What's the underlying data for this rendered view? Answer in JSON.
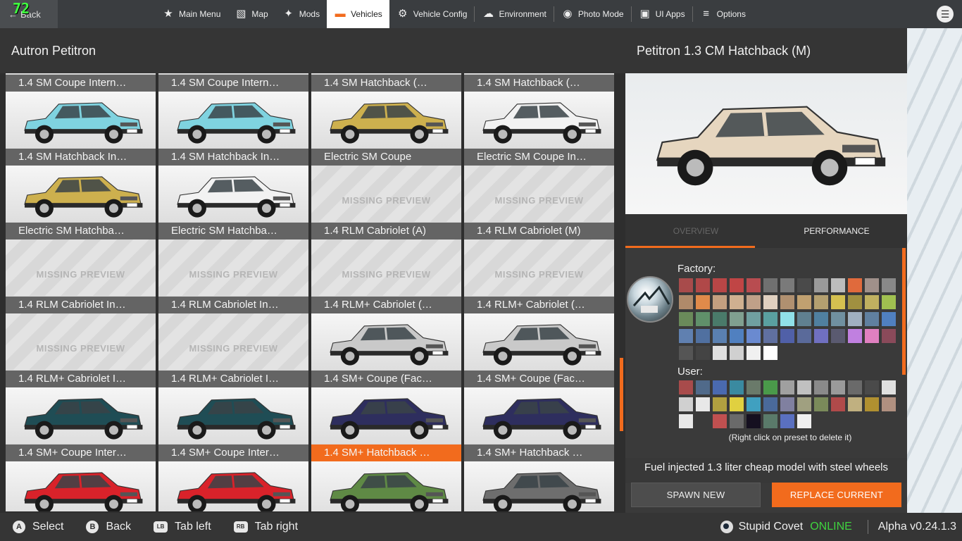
{
  "overlay": {
    "fps": "72"
  },
  "topbar": {
    "back_label": "Back",
    "nav": [
      {
        "label": "Main Menu",
        "icon": "star-square-icon"
      },
      {
        "label": "Map",
        "icon": "map-icon"
      },
      {
        "label": "Mods",
        "icon": "puzzle-icon"
      },
      {
        "label": "Vehicles",
        "icon": "car-icon",
        "active": true
      },
      {
        "label": "Vehicle Config",
        "icon": "engine-icon"
      },
      {
        "label": "Environment",
        "icon": "weather-icon"
      },
      {
        "label": "Photo Mode",
        "icon": "camera-icon"
      },
      {
        "label": "UI Apps",
        "icon": "apps-icon"
      },
      {
        "label": "Options",
        "icon": "sliders-icon"
      }
    ]
  },
  "list": {
    "title": "Autron Petitron",
    "missing_preview": "MISSING PREVIEW",
    "top_row": [
      "1.4 SM Coupe Intern…",
      "1.4 SM Coupe Intern…",
      "1.4 SM Hatchback (…",
      "1.4 SM Hatchback (…"
    ],
    "tiles": [
      {
        "label": "1.4 SM Hatchback In…",
        "color": "#7fd3e0"
      },
      {
        "label": "1.4 SM Hatchback In…",
        "color": "#7fd3e0"
      },
      {
        "label": "Electric SM Coupe",
        "color": "#cdb04e"
      },
      {
        "label": "Electric SM Coupe In…",
        "color": "#f2f2f2"
      },
      {
        "label": "Electric SM Hatchba…",
        "color": "#cdb04e"
      },
      {
        "label": "Electric SM Hatchba…",
        "color": "#f2f2f2"
      },
      {
        "label": "1.4 RLM Cabriolet (A)",
        "missing": true
      },
      {
        "label": "1.4 RLM Cabriolet (M)",
        "missing": true
      },
      {
        "label": "1.4 RLM Cabriolet In…",
        "missing": true
      },
      {
        "label": "1.4 RLM Cabriolet In…",
        "missing": true
      },
      {
        "label": "1.4 RLM+ Cabriolet (…",
        "missing": true
      },
      {
        "label": "1.4 RLM+ Cabriolet (…",
        "missing": true
      },
      {
        "label": "1.4 RLM+ Cabriolet I…",
        "missing": true
      },
      {
        "label": "1.4 RLM+ Cabriolet I…",
        "missing": true
      },
      {
        "label": "1.4 SM+ Coupe (Fac…",
        "color": "#c9c9c9"
      },
      {
        "label": "1.4 SM+ Coupe (Fac…",
        "color": "#c9c9c9"
      },
      {
        "label": "1.4 SM+ Coupe Inter…",
        "color": "#1f4d55"
      },
      {
        "label": "1.4 SM+ Coupe Inter…",
        "color": "#1f4d55"
      },
      {
        "label": "1.4 SM+ Hatchback …",
        "color": "#2e2e5e",
        "selected": true
      },
      {
        "label": "1.4 SM+ Hatchback …",
        "color": "#2e2e5e"
      },
      {
        "label": "",
        "color": "#d9222a"
      },
      {
        "label": "",
        "color": "#d9222a"
      },
      {
        "label": "",
        "color": "#5f8a45"
      },
      {
        "label": "",
        "color": "#6e6e6e"
      }
    ]
  },
  "detail": {
    "title": "Petitron 1.3 CM Hatchback (M)",
    "car_color": "#e6d6bf",
    "tabs": [
      "OVERVIEW",
      "PERFORMANCE"
    ],
    "factory_label": "Factory:",
    "user_label": "User:",
    "factory_colors": [
      "#a84b4b",
      "#b04848",
      "#b84646",
      "#c04545",
      "#b84c50",
      "#707070",
      "#7a7a7a",
      "#4a4a4a",
      "#9a9a9a",
      "#bcbcbc",
      "#e06a3c",
      "#a0908a",
      "#888888",
      "#b08a6a",
      "#e08a4a",
      "#c4a080",
      "#d0b090",
      "#c0a088",
      "#e0d0c0",
      "#b09070",
      "#c0a070",
      "#b4a070",
      "#d4c050",
      "#a09040",
      "#c0b060",
      "#a0c050",
      "#6a8a5a",
      "#60906a",
      "#4a7a6a",
      "#80a090",
      "#70a0a0",
      "#5aa0a0",
      "#90e0e8",
      "#608090",
      "#5080a0",
      "#7090a0",
      "#a0b0c0",
      "#6080a0",
      "#5080c0",
      "#6080b0",
      "#5070a0",
      "#5a80b0",
      "#5080c0",
      "#6a8ad0",
      "#6070a0",
      "#5060a8",
      "#5a6a9a",
      "#7070c0",
      "#5a5a70",
      "#c080e0",
      "#e080c0",
      "#8a4a5a",
      "#555555",
      "#444444",
      "#e0e0e0",
      "#d0d0d0",
      "#f0f0f0",
      "#ffffff"
    ],
    "user_colors": [
      "#a84b4b",
      "#506a8a",
      "#4a6ab0",
      "#3a8aa0",
      "#6a7a6a",
      "#4a9a4a",
      "#a0a0a0",
      "#c0c0c0",
      "#8a8a8a",
      "#9a9a9a",
      "#6a6a6a",
      "#4a4a4a",
      "#e0e0e0",
      "#d0d0d0",
      "#e8e8e8",
      "#b0a040",
      "#e0d040",
      "#40a0c0",
      "#4a6a9a",
      "#8080a0",
      "#a0a080",
      "#7a8a5a",
      "#b04a4a",
      "#c0b080",
      "#b09030",
      "#b09080",
      "#e8e8e8",
      "#3a3a3a",
      "#c05050",
      "#6a6a6a",
      "#151020",
      "#5a7a6a",
      "#5a70c0",
      "#f0f0f0"
    ],
    "hint": "(Right click on preset to delete it)",
    "description": "Fuel injected 1.3 liter cheap model with steel wheels",
    "spawn_label": "SPAWN NEW",
    "replace_label": "REPLACE CURRENT"
  },
  "bottombar": {
    "hints": [
      {
        "key": "A",
        "label": "Select"
      },
      {
        "key": "B",
        "label": "Back"
      },
      {
        "key": "LB",
        "label": "Tab left"
      },
      {
        "key": "RB",
        "label": "Tab right"
      }
    ],
    "user": "Stupid Covet",
    "status": "ONLINE",
    "version": "Alpha v0.24.1.3"
  }
}
